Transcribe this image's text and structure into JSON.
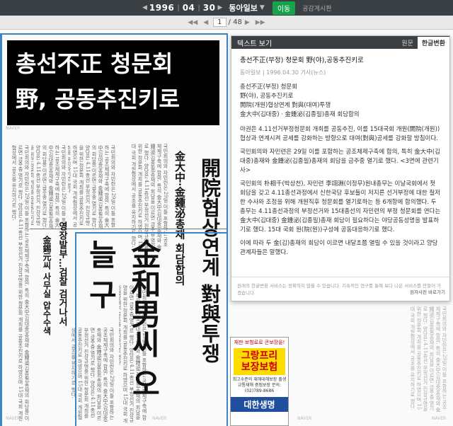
{
  "topbar": {
    "prev_arrow": "◀",
    "year": "1996",
    "month": "04",
    "day": "30",
    "next_arrow": "▶",
    "newspaper": "동아일보",
    "dropdown_arrow": "▼",
    "move_button": "이동",
    "notice": "공감게시판"
  },
  "pagebar": {
    "first": "◀◀",
    "prev": "◀",
    "current": "1",
    "total": "/ 48",
    "next": "▶",
    "last": "▶▶"
  },
  "newspaper": {
    "headline_line1": "총선不正 청문회",
    "headline_line2": "野, 공동추진키로",
    "col_kim_jongpil": "金大中·金鍾泌총재 회담합의",
    "col_kaewon": "開院협상연계 對與투쟁",
    "col_kim_hwanam": "金和男씨 오늘 구",
    "col_youngjang": "영장발부…검찰 검거나서",
    "col_kim_sungwon": "金錫元씨 사무실 압수수색",
    "small_text": "국민회의와 자민련은 29일 이틀 포함하는 공조체제구축에 합의, 특히 金大中(김대중)총재와 金鍾泌(김종필)총재의 회담을 이르면 금주중 열기로 했다. 양당은 4.11총선 부정선거 진상규명을 위한 청문회 개최를 공동추진키로 하였으며 15대 국회 개원협상에서 공조를 유지하기로 했다."
  },
  "textpanel": {
    "header_title": "텍스트 보기",
    "tab_original": "원문",
    "tab_hangul": "한글변환",
    "article_title": "총선不正(부정) 청문회 野(야),공동추진키로",
    "meta": "동아일보 | 1996.04.30 기사(뉴스)",
    "summary_1": "총선不正(부정) 청문회",
    "summary_2": "野(야), 공동추진키로",
    "summary_3": "開院(개원)협상연계 對與(대여)투쟁",
    "summary_4": "金大中(김대중)ㆍ金鍾泌(김종필)총재 회담합의",
    "para_1": "야권은 4.11선거부정청문회 개최를 공동추진, 이를 15대국회 개원(開院(개원)) 협상과 연계시켜 공세를 강화하는 방향으로 대여(對與)공세를 강화할 방침이다.",
    "para_2": "국민회의와 자민련은 29일 이를 포함하는 공조체제구축에 합의, 특히 金大中(김대중)총재와 金鍾泌(김종필)총재의 회담을 금주중 열기로 했다. <3면에 관련기사>",
    "para_3": "국민회의 朴相千(박상천), 자민련 李翊淵(이정무)원내총무는 이날국회에서 첫 회담을 갖고 4.11총선과정에서 신한국당 후보들이 저지른 선거부정에 대한 철저한 수사와 조정을 위해 개원직후 청문회를 열기로하는 등 6개항에 합의했다. 두 총무는 4.11총선과정의 부정선거와 15대총선의 자민련의 부정 청문회를 연다는 金大中(김대중) 金鍾泌(김종필)총재 회담이 필요하다는 야당공동성명을 발표하기로 했다. 15대 국회 원(院(원))구성에 공동대응하기로 했다.",
    "para_4": "이에 따라 두 金(김)총재의 회담이 이르면 내달초쯤 열릴 수 있을 것이라고 양당 관계자들은 말했다.",
    "footer_text": "원래의 한글변환 서비스는 정확하지 않을 수 있습니다. 지속적인 연구를 통해 보다 나은 서비스를 만들어 가겠습니다.",
    "footer_link": "원자사전 바로가기"
  },
  "ad": {
    "top": "재판 보험료로 큰보장을!",
    "brand_line1": "그랑프리",
    "brand_line2": "보장보험",
    "details": "최고수준의 재해대해보장 출생 교통재해 중점보장 문의: (02)789-8686",
    "company": "대한생명"
  },
  "watermark": "NAVER",
  "colors": {
    "topbar_bg": "#3a3f44",
    "move_button": "#16a34a",
    "headline_bg": "#000000",
    "frame_blue": "#3c83c8"
  }
}
